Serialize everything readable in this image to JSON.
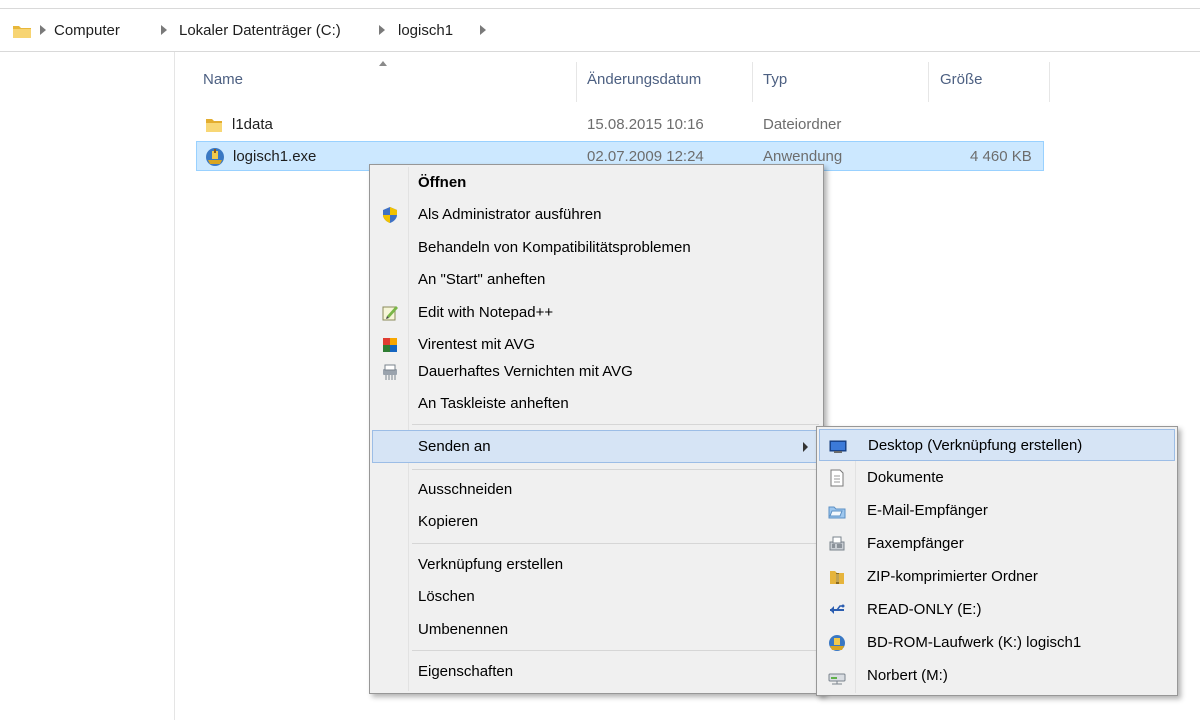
{
  "breadcrumb": {
    "items": [
      "Computer",
      "Lokaler Datenträger (C:)",
      "logisch1"
    ]
  },
  "columns": {
    "name": "Name",
    "date": "Änderungsdatum",
    "type": "Typ",
    "size": "Größe"
  },
  "files": [
    {
      "name": "l1data",
      "date": "15.08.2015 10:16",
      "type": "Dateiordner",
      "size": "",
      "icon": "folder-icon",
      "selected": false
    },
    {
      "name": "logisch1.exe",
      "date": "02.07.2009 12:24",
      "type": "Anwendung",
      "size": "4 460 KB",
      "icon": "application-icon",
      "selected": true
    }
  ],
  "context_menu": {
    "open": "Öffnen",
    "run_as_admin": "Als Administrator ausführen",
    "troubleshoot": "Behandeln von Kompatibilitätsproblemen",
    "pin_start": "An \"Start\" anheften",
    "edit_notepad": "Edit with Notepad++",
    "virus_scan": "Virentest mit AVG",
    "shred": "Dauerhaftes Vernichten mit AVG",
    "pin_taskbar": "An Taskleiste anheften",
    "send_to": "Senden an",
    "cut": "Ausschneiden",
    "copy": "Kopieren",
    "create_shortcut": "Verknüpfung erstellen",
    "delete": "Löschen",
    "rename": "Umbenennen",
    "properties": "Eigenschaften"
  },
  "send_to_menu": {
    "desktop": "Desktop (Verknüpfung erstellen)",
    "documents": "Dokumente",
    "mail": "E-Mail-Empfänger",
    "fax": "Faxempfänger",
    "zip": "ZIP-komprimierter Ordner",
    "readonly": "READ-ONLY (E:)",
    "bdrom": "BD-ROM-Laufwerk (K:) logisch1",
    "norbert": "Norbert (M:)"
  },
  "colors": {
    "selection_bg": "#cce8ff",
    "selection_border": "#99d1ff",
    "menu_bg": "#f0f0f0",
    "menu_highlight": "#d6e4f5",
    "header_text": "#4d6082"
  }
}
